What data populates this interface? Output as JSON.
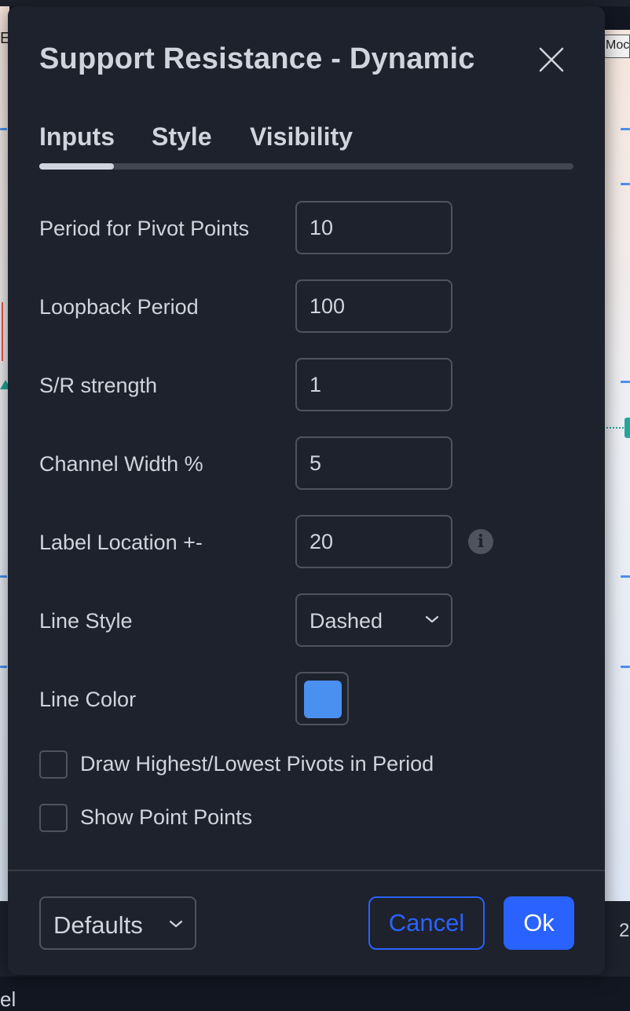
{
  "background": {
    "top_right_label": "Moc",
    "top_left_glyph": "E",
    "bottom_left_text": "el",
    "bottom_right_text": "2"
  },
  "dialog": {
    "title": "Support Resistance - Dynamic",
    "close_icon": "close-icon",
    "tabs": [
      {
        "label": "Inputs",
        "active": true
      },
      {
        "label": "Style",
        "active": false
      },
      {
        "label": "Visibility",
        "active": false
      }
    ],
    "inputs": {
      "pivot_period": {
        "label": "Period for Pivot Points",
        "value": "10"
      },
      "loopback_period": {
        "label": "Loopback Period",
        "value": "100"
      },
      "sr_strength": {
        "label": "S/R strength",
        "value": "1"
      },
      "channel_width": {
        "label": "Channel Width %",
        "value": "5"
      },
      "label_location": {
        "label": "Label Location +-",
        "value": "20",
        "info_icon": "info-icon"
      },
      "line_style": {
        "label": "Line Style",
        "value": "Dashed",
        "icon": "chevron-down-icon"
      },
      "line_color": {
        "label": "Line Color",
        "value": "#4a90f0"
      }
    },
    "checkboxes": [
      {
        "label": "Draw Highest/Lowest Pivots in Period",
        "checked": false
      },
      {
        "label": "Show Point Points",
        "checked": false
      }
    ],
    "footer": {
      "defaults_label": "Defaults",
      "cancel_label": "Cancel",
      "ok_label": "Ok"
    }
  },
  "colors": {
    "dialog_bg": "#1e222d",
    "accent": "#2962ff",
    "text": "#d1d4dc",
    "border": "#50535e"
  }
}
